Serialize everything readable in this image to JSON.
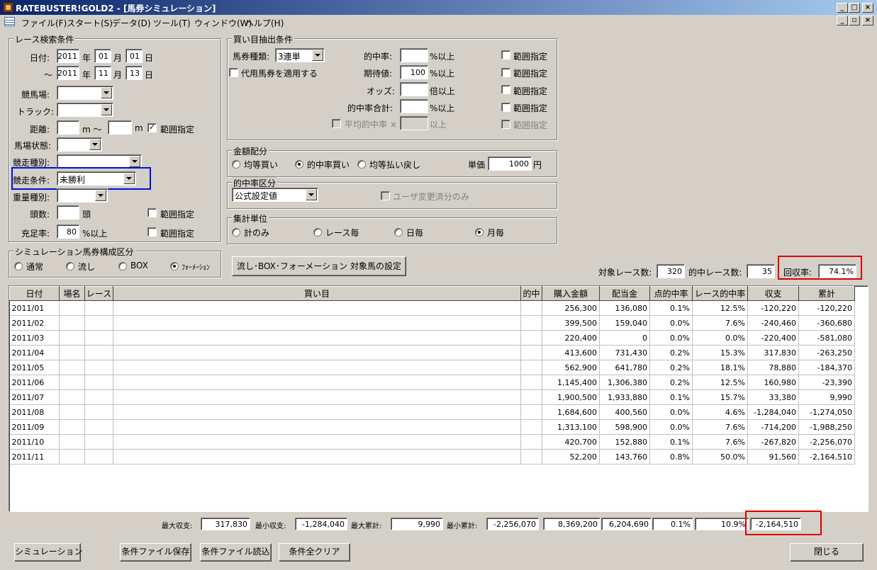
{
  "window": {
    "title": "RATEBUSTER!GOLD2 - [馬券シミュレーション]",
    "min": "_",
    "max": "□",
    "close": "×",
    "restore": "▫"
  },
  "menu": [
    "ファイル(F)",
    "スタート(S)",
    "データ(D)",
    "ツール(T)",
    "ウィンドウ(W)",
    "ヘルプ(H)"
  ],
  "race_search": {
    "title": "レース検索条件",
    "date_label": "日付:",
    "from": {
      "year": "2011",
      "month": "01",
      "day": "01"
    },
    "to_prefix": "～",
    "to": {
      "year": "2011",
      "month": "11",
      "day": "13"
    },
    "year_unit": "年",
    "month_unit": "月",
    "day_unit": "日",
    "course_label": "競馬場:",
    "course_value": "",
    "track_label": "トラック:",
    "track_value": "",
    "distance_label": "距離:",
    "distance_from": "",
    "distance_to": "",
    "m_tilde": "m ～",
    "m_unit": "m",
    "range_label": "範囲指定",
    "condition_label": "馬場状態:",
    "condition_value": "",
    "race_type_label": "競走種別:",
    "race_type_value": "",
    "race_cond_label": "競走条件:",
    "race_cond_value": "未勝利",
    "weight_label": "重量種別:",
    "weight_value": "",
    "heads_label": "頭数:",
    "heads_value": "",
    "heads_unit": "頭",
    "fill_label": "充足率:",
    "fill_value": "80",
    "fill_unit": "%以上"
  },
  "bet_extract": {
    "title": "買い目抽出条件",
    "type_label": "馬券種類:",
    "type_value": "3連単",
    "substitute_label": "代用馬券を適用する",
    "hit_rate_label": "的中率:",
    "hit_rate_value": "",
    "pct_over": "%以上",
    "expect_label": "期待値:",
    "expect_value": "100",
    "odds_label": "オッズ:",
    "odds_value": "",
    "odds_unit": "倍以上",
    "hit_total_label": "的中率合計:",
    "hit_total_value": "",
    "avg_label": "平均的中率 ×",
    "avg_value": "",
    "avg_unit": "以上",
    "range_label": "範囲指定"
  },
  "money": {
    "title": "金額配分",
    "options": [
      "均等買い",
      "的中率買い",
      "均等払い戻し"
    ],
    "unit_label": "単価",
    "unit_value": "1000",
    "yen": "円"
  },
  "hit_class": {
    "title": "的中率区分",
    "value": "公式設定値",
    "user_label": "ユーザ変更済分のみ"
  },
  "agg": {
    "title": "集計単位",
    "options": [
      "計のみ",
      "レース毎",
      "日毎",
      "月毎"
    ]
  },
  "sim": {
    "title": "シミュレーション馬券構成区分",
    "options": [
      "通常",
      "流し",
      "BOX",
      "ﾌｫｰﾒｰｼｮﾝ"
    ]
  },
  "setup_button": "流し･BOX･フォーメーション 対象馬の設定",
  "stats": {
    "races_label": "対象レース数:",
    "races": "320",
    "hit_races_label": "的中レース数:",
    "hit_races": "35",
    "return_label": "回収率:",
    "return_value": "74.1%"
  },
  "table": {
    "headers": [
      "日付",
      "場名",
      "レース",
      "買い目",
      "的中",
      "購入金額",
      "配当金",
      "点的中率",
      "レース的中率",
      "収支",
      "累計"
    ],
    "rows": [
      [
        "2011/01",
        "",
        "",
        "",
        "",
        "256,300",
        "136,080",
        "0.1%",
        "12.5%",
        "-120,220",
        "-120,220"
      ],
      [
        "2011/02",
        "",
        "",
        "",
        "",
        "399,500",
        "159,040",
        "0.0%",
        "7.6%",
        "-240,460",
        "-360,680"
      ],
      [
        "2011/03",
        "",
        "",
        "",
        "",
        "220,400",
        "0",
        "0.0%",
        "0.0%",
        "-220,400",
        "-581,080"
      ],
      [
        "2011/04",
        "",
        "",
        "",
        "",
        "413,600",
        "731,430",
        "0.2%",
        "15.3%",
        "317,830",
        "-263,250"
      ],
      [
        "2011/05",
        "",
        "",
        "",
        "",
        "562,900",
        "641,780",
        "0.2%",
        "18.1%",
        "78,880",
        "-184,370"
      ],
      [
        "2011/06",
        "",
        "",
        "",
        "",
        "1,145,400",
        "1,306,380",
        "0.2%",
        "12.5%",
        "160,980",
        "-23,390"
      ],
      [
        "2011/07",
        "",
        "",
        "",
        "",
        "1,900,500",
        "1,933,880",
        "0.1%",
        "15.7%",
        "33,380",
        "9,990"
      ],
      [
        "2011/08",
        "",
        "",
        "",
        "",
        "1,684,600",
        "400,560",
        "0.0%",
        "4.6%",
        "-1,284,040",
        "-1,274,050"
      ],
      [
        "2011/09",
        "",
        "",
        "",
        "",
        "1,313,100",
        "598,900",
        "0.0%",
        "7.6%",
        "-714,200",
        "-1,988,250"
      ],
      [
        "2011/10",
        "",
        "",
        "",
        "",
        "420,700",
        "152,880",
        "0.1%",
        "7.6%",
        "-267,820",
        "-2,256,070"
      ],
      [
        "2011/11",
        "",
        "",
        "",
        "",
        "52,200",
        "143,760",
        "0.8%",
        "50.0%",
        "91,560",
        "-2,164,510"
      ]
    ]
  },
  "footer": {
    "max_label": "最大収支:",
    "max": "317,830",
    "min_label": "最小収支:",
    "min": "-1,284,040",
    "max_cum_label": "最大累計:",
    "max_cum": "9,990",
    "min_cum_label": "最小累計:",
    "min_cum": "-2,256,070",
    "total_buy": "8,369,200",
    "total_pay": "6,204,690",
    "point_rate": "0.1%",
    "race_rate": "10.9%",
    "total_balance": "-2,164,510"
  },
  "buttons": {
    "simulate": "シミュレーション",
    "save": "条件ファイル保存",
    "load": "条件ファイル読込",
    "clear": "条件全クリア",
    "close": "閉じる"
  }
}
